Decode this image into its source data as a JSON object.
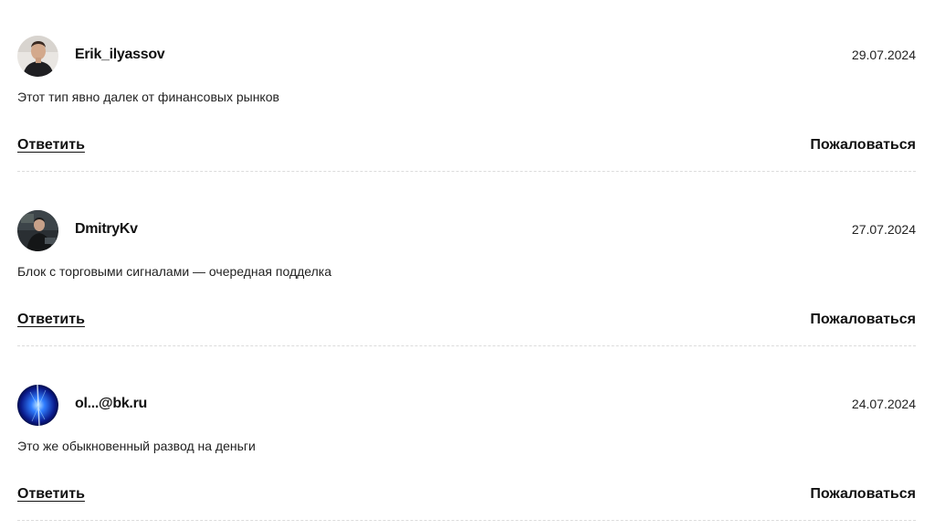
{
  "comments": [
    {
      "author": "Erik_ilyassov",
      "date": "29.07.2024",
      "text": "Этот тип явно далек от финансовых рынков",
      "reply_label": "Ответить",
      "report_label": "Пожаловаться",
      "avatar_icon": "user-photo-icon"
    },
    {
      "author": "DmitryKv",
      "date": "27.07.2024",
      "text": "Блок с торговыми сигналами — очередная подделка",
      "reply_label": "Ответить",
      "report_label": "Пожаловаться",
      "avatar_icon": "user-photo-icon"
    },
    {
      "author": "ol...@bk.ru",
      "date": "24.07.2024",
      "text": "Это же обыкновенный развод на деньги",
      "reply_label": "Ответить",
      "report_label": "Пожаловаться",
      "avatar_icon": "user-photo-icon"
    }
  ]
}
